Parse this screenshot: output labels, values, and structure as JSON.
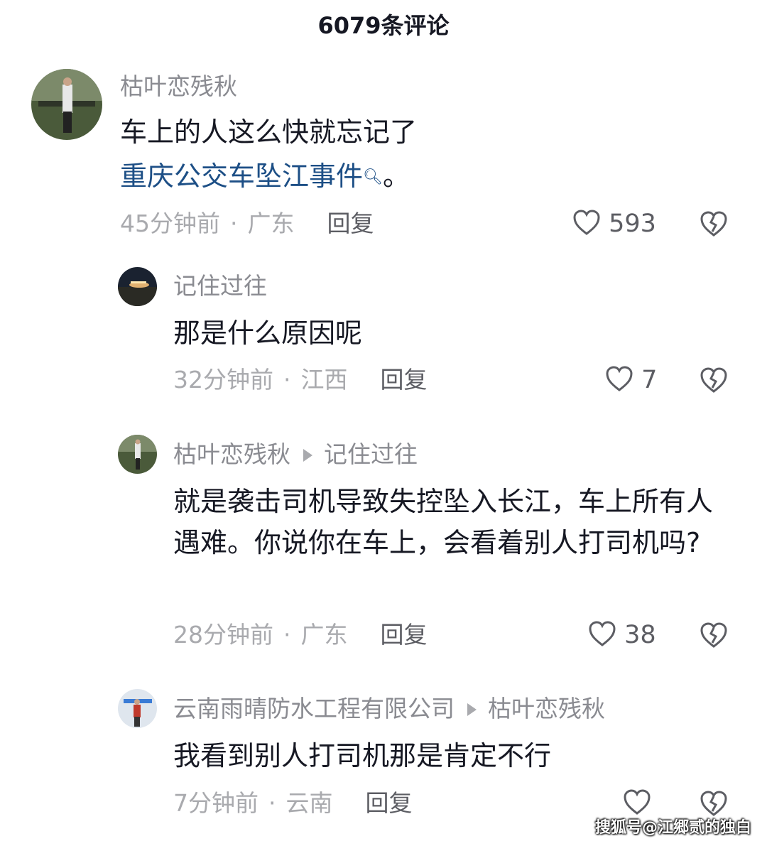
{
  "header": {
    "title": "6079条评论"
  },
  "comments": [
    {
      "user": "枯叶恋残秋",
      "text": "车上的人这么快就忘记了",
      "link": "重庆公交车坠江事件",
      "text_suffix": "。",
      "time": "45分钟前",
      "location": "广东",
      "reply_label": "回复",
      "likes": "593"
    },
    {
      "user": "记住过往",
      "text": "那是什么原因呢",
      "time": "32分钟前",
      "location": "江西",
      "reply_label": "回复",
      "likes": "7"
    },
    {
      "user": "枯叶恋残秋",
      "reply_to": "记住过往",
      "text": "就是袭击司机导致失控坠入长江，车上所有人遇难。你说你在车上，会看着别人打司机吗?",
      "time": "28分钟前",
      "location": "广东",
      "reply_label": "回复",
      "likes": "38"
    },
    {
      "user": "云南雨晴防水工程有限公司",
      "reply_to": "枯叶恋残秋",
      "text": "我看到别人打司机那是肯定不行",
      "time": "7分钟前",
      "location": "云南",
      "reply_label": "回复",
      "likes": ""
    }
  ],
  "icons": {
    "like": "heart-outline-icon",
    "dislike": "broken-heart-icon",
    "search": "search-icon"
  },
  "watermark": "搜狐号@江郷贰的独白",
  "colors": {
    "link": "#1d4f86",
    "meta": "#a9aaae",
    "username": "#8a8b91"
  }
}
